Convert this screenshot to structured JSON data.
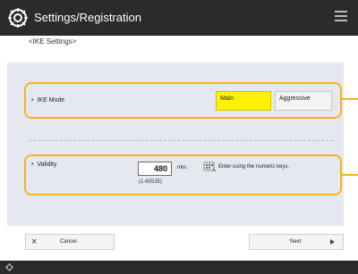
{
  "header": {
    "title": "Settings/Registration",
    "title_icon": "settings-icon",
    "menu_icon": "menu-icon"
  },
  "breadcrumb": "<IKE Settings>",
  "ike_mode": {
    "label": "IKE Mode",
    "options": [
      "Main",
      "Aggressive"
    ],
    "selected": "Main"
  },
  "validity": {
    "label": "Validity",
    "value": "480",
    "unit": "min.",
    "range": "(1-65535)",
    "hint": "Enter using the numeric keys.",
    "hint_icon": "keypad-icon"
  },
  "footer": {
    "cancel_label": "Cancel",
    "next_label": "Next"
  },
  "colors": {
    "titlebar": "#2b2b2b",
    "panel": "#e5e8ef",
    "highlight": "#f4b41a",
    "selected": "#fff200"
  }
}
